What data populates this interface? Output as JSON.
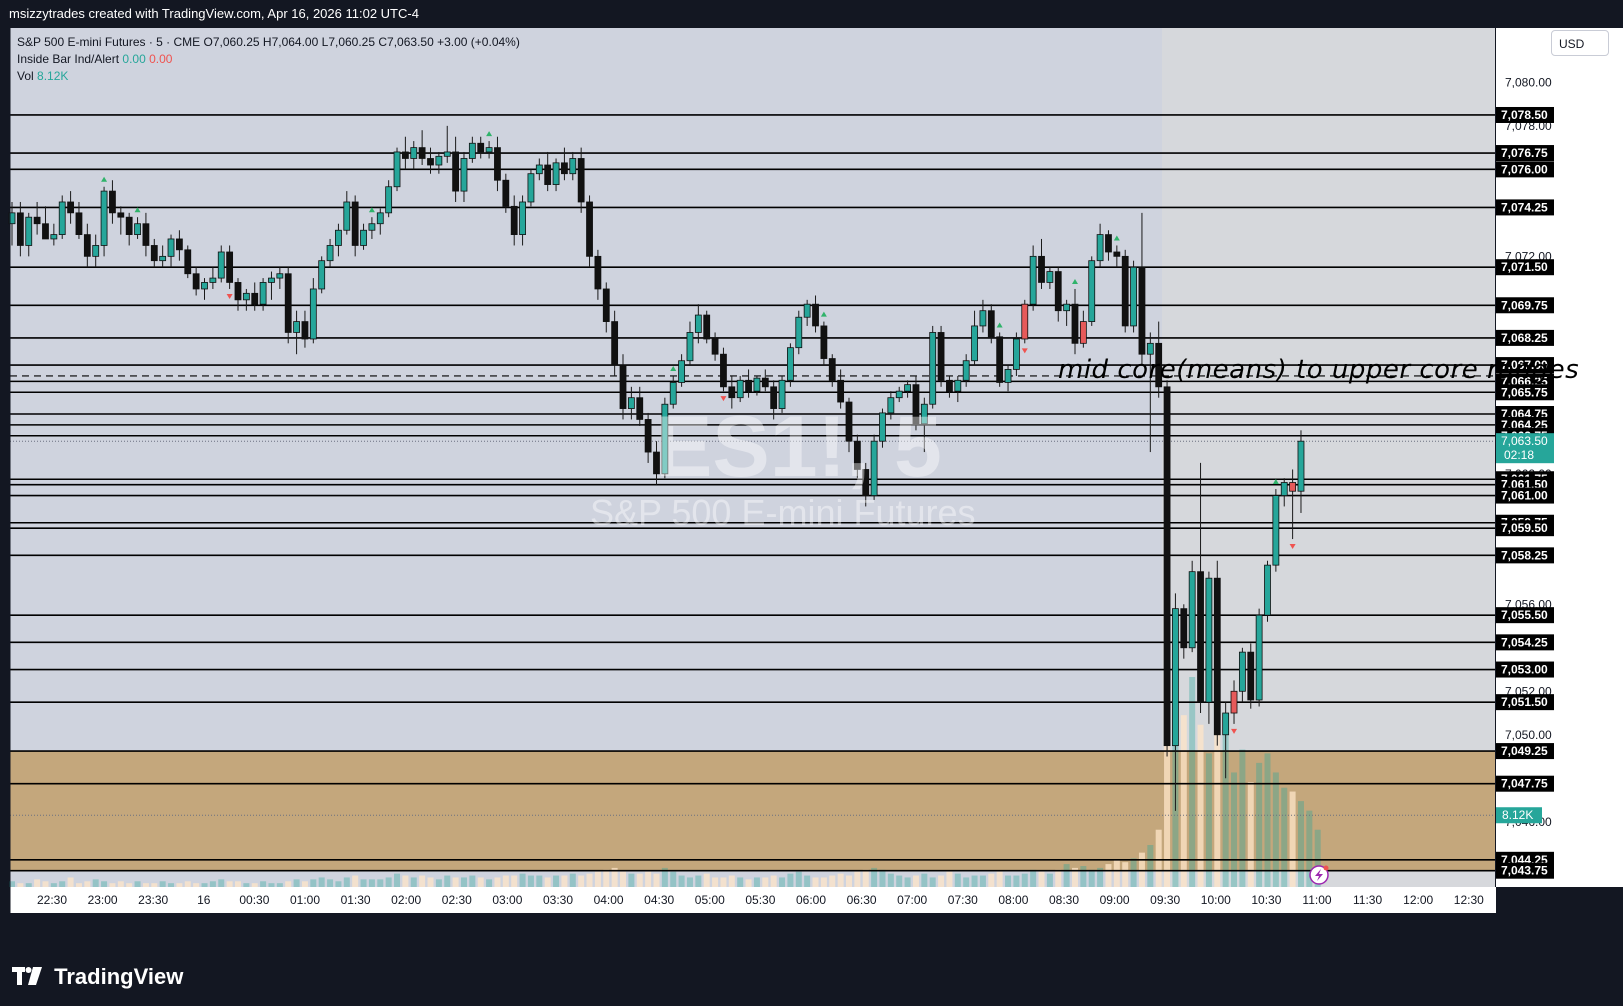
{
  "header": {
    "attribution": "msizzytrades created with TradingView.com, Apr 16, 2026 11:02 UTC-4"
  },
  "legend": {
    "symbol_line": "S&P 500 E-mini Futures · 5 · CME",
    "ohlc": {
      "o": "O7,060.25",
      "h": "H7,064.00",
      "l": "L7,060.25",
      "c": "C7,063.50",
      "chg": "+3.00 (+0.04%)"
    },
    "indicator_name": "Inside Bar Ind/Alert",
    "indicator_v1": "0.00",
    "indicator_v2": "0.00",
    "vol_label": "Vol",
    "vol_value": "8.12K"
  },
  "watermark": {
    "symbol": "ES1!, 5",
    "name": "S&P 500 E-mini Futures"
  },
  "annotation": {
    "text": "mid core(means) to upper core ranges"
  },
  "currency": "USD",
  "logo": "TradingView",
  "colors": {
    "background": "#131722",
    "pane": "#cfd3de",
    "pane_right": "#d6d8dc",
    "zone": "#c4a77c",
    "up": "#26a69a",
    "down": "#111111",
    "inside_bar": "#e65a5a",
    "level_line": "#000000",
    "price_tag": "#26a69a"
  },
  "chart_data": {
    "type": "candlestick",
    "instrument": "S&P 500 E-mini Futures",
    "interval": "5",
    "ylim": [
      7043.0,
      7082.5
    ],
    "y_ticks": [
      "7,080.00",
      "7,078.00",
      "7,072.00",
      "7,062.00",
      "7,056.00",
      "7,052.00",
      "7,050.00",
      "7,046.00"
    ],
    "x_ticks": [
      "22:30",
      "23:00",
      "23:30",
      "16",
      "00:30",
      "01:00",
      "01:30",
      "02:00",
      "02:30",
      "03:00",
      "03:30",
      "04:00",
      "04:30",
      "05:00",
      "05:30",
      "06:00",
      "06:30",
      "07:00",
      "07:30",
      "08:00",
      "08:30",
      "09:00",
      "09:30",
      "10:00",
      "10:30",
      "11:00",
      "11:30",
      "12:00",
      "12:30"
    ],
    "levels": [
      {
        "label": "7,078.50",
        "value": 7078.5
      },
      {
        "label": "7,076.75",
        "value": 7076.75
      },
      {
        "label": "7,076.00",
        "value": 7076.0
      },
      {
        "label": "7,074.25",
        "value": 7074.25
      },
      {
        "label": "7,071.50",
        "value": 7071.5
      },
      {
        "label": "7,069.75",
        "value": 7069.75
      },
      {
        "label": "7,068.25",
        "value": 7068.25
      },
      {
        "label": "7,067.00",
        "value": 7067.0
      },
      {
        "label": "7,066.25",
        "value": 7066.25
      },
      {
        "label": "7,065.75",
        "value": 7065.75
      },
      {
        "label": "7,064.75",
        "value": 7064.75
      },
      {
        "label": "7,064.25",
        "value": 7064.25
      },
      {
        "label": "7,063.75",
        "value": 7063.75
      },
      {
        "label": "7,061.75",
        "value": 7061.75
      },
      {
        "label": "7,061.50",
        "value": 7061.5
      },
      {
        "label": "7,061.00",
        "value": 7061.0
      },
      {
        "label": "7,059.75",
        "value": 7059.75
      },
      {
        "label": "7,059.50",
        "value": 7059.5
      },
      {
        "label": "7,058.25",
        "value": 7058.25
      },
      {
        "label": "7,055.50",
        "value": 7055.5
      },
      {
        "label": "7,054.25",
        "value": 7054.25
      },
      {
        "label": "7,053.00",
        "value": 7053.0
      },
      {
        "label": "7,051.50",
        "value": 7051.5
      },
      {
        "label": "7,049.25",
        "value": 7049.25
      },
      {
        "label": "7,047.75",
        "value": 7047.75
      },
      {
        "label": "7,044.25",
        "value": 7044.25
      },
      {
        "label": "7,043.75",
        "value": 7043.75
      }
    ],
    "dashed_level": 7066.5,
    "zone": {
      "from": 7043.75,
      "to": 7049.25
    },
    "last_price": {
      "label": "7,063.50",
      "value": 7063.5,
      "countdown": "02:18"
    },
    "volume_tag": "8.12K",
    "candles": [
      [
        7073.5,
        7074.5,
        7072.5,
        7074.0
      ],
      [
        7074.0,
        7074.5,
        7072.0,
        7072.5
      ],
      [
        7072.5,
        7074.0,
        7072.0,
        7073.8
      ],
      [
        7073.8,
        7074.5,
        7073.0,
        7073.5
      ],
      [
        7073.5,
        7074.3,
        7072.8,
        7072.8
      ],
      [
        7072.8,
        7073.5,
        7072.5,
        7073.0
      ],
      [
        7073.0,
        7074.8,
        7072.8,
        7074.5
      ],
      [
        7074.5,
        7075.0,
        7073.5,
        7074.0
      ],
      [
        7074.0,
        7074.5,
        7072.8,
        7073.0
      ],
      [
        7073.0,
        7073.5,
        7071.5,
        7072.0
      ],
      [
        7072.0,
        7073.0,
        7071.5,
        7072.5
      ],
      [
        7072.5,
        7075.2,
        7072.0,
        7075.0
      ],
      [
        7075.0,
        7075.5,
        7073.5,
        7074.0
      ],
      [
        7074.0,
        7074.3,
        7073.0,
        7073.8
      ],
      [
        7073.8,
        7074.0,
        7072.5,
        7073.0
      ],
      [
        7073.0,
        7073.8,
        7072.8,
        7073.5
      ],
      [
        7073.5,
        7074.0,
        7072.0,
        7072.5
      ],
      [
        7072.5,
        7072.8,
        7071.5,
        7071.8
      ],
      [
        7071.8,
        7072.5,
        7071.5,
        7072.0
      ],
      [
        7072.0,
        7073.0,
        7071.5,
        7072.8
      ],
      [
        7072.8,
        7073.2,
        7071.8,
        7072.3
      ],
      [
        7072.3,
        7072.5,
        7071.0,
        7071.2
      ],
      [
        7071.2,
        7071.5,
        7070.2,
        7070.5
      ],
      [
        7070.5,
        7071.0,
        7070.0,
        7070.8
      ],
      [
        7070.8,
        7071.5,
        7070.5,
        7071.0
      ],
      [
        7071.0,
        7072.5,
        7070.8,
        7072.2
      ],
      [
        7072.2,
        7072.5,
        7070.5,
        7070.8
      ],
      [
        7070.8,
        7071.0,
        7069.5,
        7070.0
      ],
      [
        7070.0,
        7070.5,
        7069.5,
        7070.3
      ],
      [
        7070.3,
        7070.8,
        7069.5,
        7069.8
      ],
      [
        7069.8,
        7071.0,
        7069.5,
        7070.8
      ],
      [
        7070.8,
        7071.3,
        7070.0,
        7071.0
      ],
      [
        7071.0,
        7071.5,
        7070.5,
        7071.2
      ],
      [
        7071.2,
        7071.5,
        7068.0,
        7068.5
      ],
      [
        7068.5,
        7069.5,
        7067.5,
        7069.0
      ],
      [
        7069.0,
        7069.5,
        7067.8,
        7068.2
      ],
      [
        7068.2,
        7071.0,
        7068.0,
        7070.5
      ],
      [
        7070.5,
        7072.0,
        7070.3,
        7071.8
      ],
      [
        7071.8,
        7072.8,
        7071.5,
        7072.5
      ],
      [
        7072.5,
        7073.5,
        7072.0,
        7073.2
      ],
      [
        7073.2,
        7075.0,
        7073.0,
        7074.5
      ],
      [
        7074.5,
        7074.8,
        7072.0,
        7072.5
      ],
      [
        7072.5,
        7073.5,
        7072.3,
        7073.2
      ],
      [
        7073.2,
        7073.8,
        7072.8,
        7073.5
      ],
      [
        7073.5,
        7074.2,
        7073.0,
        7074.0
      ],
      [
        7074.0,
        7075.5,
        7073.8,
        7075.2
      ],
      [
        7075.2,
        7077.0,
        7075.0,
        7076.8
      ],
      [
        7076.8,
        7077.5,
        7076.0,
        7076.5
      ],
      [
        7076.5,
        7077.3,
        7076.0,
        7077.0
      ],
      [
        7077.0,
        7077.8,
        7076.2,
        7076.5
      ],
      [
        7076.5,
        7077.0,
        7075.8,
        7076.2
      ],
      [
        7076.2,
        7076.8,
        7075.8,
        7076.6
      ],
      [
        7076.6,
        7078.0,
        7076.3,
        7076.8
      ],
      [
        7076.8,
        7077.5,
        7074.5,
        7075.0
      ],
      [
        7075.0,
        7076.8,
        7074.5,
        7076.5
      ],
      [
        7076.5,
        7077.5,
        7076.3,
        7077.2
      ],
      [
        7077.2,
        7077.5,
        7076.5,
        7076.8
      ],
      [
        7076.8,
        7077.3,
        7076.5,
        7077.0
      ],
      [
        7077.0,
        7077.5,
        7075.0,
        7075.5
      ],
      [
        7075.5,
        7075.8,
        7074.0,
        7074.3
      ],
      [
        7074.3,
        7074.8,
        7072.5,
        7073.0
      ],
      [
        7073.0,
        7074.8,
        7072.5,
        7074.5
      ],
      [
        7074.5,
        7076.0,
        7074.3,
        7075.8
      ],
      [
        7075.8,
        7076.5,
        7075.5,
        7076.2
      ],
      [
        7076.2,
        7076.8,
        7075.0,
        7075.3
      ],
      [
        7075.3,
        7076.5,
        7075.0,
        7076.3
      ],
      [
        7076.3,
        7077.0,
        7075.5,
        7075.8
      ],
      [
        7075.8,
        7076.8,
        7075.5,
        7076.5
      ],
      [
        7076.5,
        7077.0,
        7074.0,
        7074.5
      ],
      [
        7074.5,
        7074.8,
        7071.5,
        7072.0
      ],
      [
        7072.0,
        7072.3,
        7070.0,
        7070.5
      ],
      [
        7070.5,
        7070.8,
        7068.5,
        7069.0
      ],
      [
        7069.0,
        7069.5,
        7066.5,
        7067.0
      ],
      [
        7067.0,
        7067.5,
        7064.5,
        7065.0
      ],
      [
        7065.0,
        7066.0,
        7064.5,
        7065.5
      ],
      [
        7065.5,
        7066.0,
        7064.2,
        7064.5
      ],
      [
        7064.5,
        7064.8,
        7062.5,
        7063.0
      ],
      [
        7063.0,
        7063.5,
        7061.5,
        7062.0
      ],
      [
        7062.0,
        7065.5,
        7061.8,
        7065.2
      ],
      [
        7065.2,
        7066.5,
        7065.0,
        7066.2
      ],
      [
        7066.2,
        7067.5,
        7066.0,
        7067.2
      ],
      [
        7067.2,
        7069.0,
        7067.0,
        7068.5
      ],
      [
        7068.5,
        7069.8,
        7068.0,
        7069.3
      ],
      [
        7069.3,
        7069.5,
        7068.0,
        7068.2
      ],
      [
        7068.2,
        7068.5,
        7067.2,
        7067.5
      ],
      [
        7067.5,
        7067.8,
        7065.8,
        7066.0
      ],
      [
        7066.0,
        7066.5,
        7065.0,
        7065.5
      ],
      [
        7065.5,
        7066.5,
        7065.3,
        7066.3
      ],
      [
        7066.3,
        7066.8,
        7065.5,
        7065.8
      ],
      [
        7065.8,
        7066.5,
        7065.6,
        7066.4
      ],
      [
        7066.4,
        7066.8,
        7065.8,
        7066.0
      ],
      [
        7066.0,
        7066.3,
        7064.5,
        7065.0
      ],
      [
        7065.0,
        7066.5,
        7064.8,
        7066.3
      ],
      [
        7066.3,
        7068.0,
        7066.0,
        7067.8
      ],
      [
        7067.8,
        7069.5,
        7067.5,
        7069.2
      ],
      [
        7069.2,
        7070.0,
        7068.8,
        7069.8
      ],
      [
        7069.8,
        7070.2,
        7068.5,
        7068.8
      ],
      [
        7068.8,
        7069.0,
        7067.0,
        7067.3
      ],
      [
        7067.3,
        7067.5,
        7066.0,
        7066.3
      ],
      [
        7066.3,
        7066.8,
        7065.0,
        7065.3
      ],
      [
        7065.3,
        7065.5,
        7063.0,
        7063.5
      ],
      [
        7063.5,
        7063.8,
        7061.8,
        7062.2
      ],
      [
        7062.2,
        7062.5,
        7060.5,
        7061.0
      ],
      [
        7061.0,
        7063.8,
        7060.8,
        7063.5
      ],
      [
        7063.5,
        7065.0,
        7063.2,
        7064.8
      ],
      [
        7064.8,
        7065.8,
        7064.5,
        7065.5
      ],
      [
        7065.5,
        7066.0,
        7065.3,
        7065.8
      ],
      [
        7065.8,
        7066.3,
        7065.5,
        7066.1
      ],
      [
        7066.1,
        7066.5,
        7064.0,
        7064.3
      ],
      [
        7064.3,
        7065.5,
        7063.0,
        7065.2
      ],
      [
        7065.2,
        7068.8,
        7065.0,
        7068.5
      ],
      [
        7068.5,
        7068.8,
        7066.0,
        7066.3
      ],
      [
        7066.3,
        7066.5,
        7065.5,
        7065.8
      ],
      [
        7065.8,
        7066.5,
        7065.3,
        7066.3
      ],
      [
        7066.3,
        7067.5,
        7066.0,
        7067.2
      ],
      [
        7067.2,
        7069.5,
        7067.0,
        7068.8
      ],
      [
        7068.8,
        7070.0,
        7068.5,
        7069.5
      ],
      [
        7069.5,
        7069.8,
        7068.0,
        7068.3
      ],
      [
        7068.3,
        7068.5,
        7066.0,
        7066.2
      ],
      [
        7066.2,
        7067.0,
        7065.8,
        7066.8
      ],
      [
        7066.8,
        7068.5,
        7066.5,
        7068.2
      ],
      [
        7068.2,
        7070.0,
        7068.0,
        7069.8
      ],
      [
        7069.8,
        7072.5,
        7069.5,
        7072.0
      ],
      [
        7072.0,
        7072.8,
        7070.5,
        7070.8
      ],
      [
        7070.8,
        7071.5,
        7070.5,
        7071.3
      ],
      [
        7071.3,
        7071.5,
        7069.0,
        7069.5
      ],
      [
        7069.5,
        7070.0,
        7068.8,
        7069.8
      ],
      [
        7069.8,
        7070.5,
        7067.5,
        7068.0
      ],
      [
        7068.0,
        7069.5,
        7067.8,
        7069.0
      ],
      [
        7069.0,
        7072.0,
        7068.8,
        7071.8
      ],
      [
        7071.8,
        7073.5,
        7071.5,
        7073.0
      ],
      [
        7073.0,
        7073.2,
        7071.8,
        7072.2
      ],
      [
        7072.2,
        7072.5,
        7071.5,
        7072.0
      ],
      [
        7072.0,
        7072.3,
        7068.5,
        7068.8
      ],
      [
        7068.8,
        7071.8,
        7068.5,
        7071.5
      ],
      [
        7071.5,
        7074.0,
        7067.0,
        7067.5
      ],
      [
        7067.5,
        7068.5,
        7063.0,
        7068.0
      ],
      [
        7068.0,
        7069.0,
        7065.5,
        7066.0
      ],
      [
        7066.0,
        7066.3,
        7049.0,
        7049.5
      ],
      [
        7049.5,
        7056.5,
        7046.5,
        7055.8
      ],
      [
        7055.8,
        7056.0,
        7053.5,
        7054.0
      ],
      [
        7054.0,
        7058.0,
        7053.8,
        7057.5
      ],
      [
        7057.5,
        7062.5,
        7051.0,
        7051.5
      ],
      [
        7051.5,
        7057.5,
        7050.5,
        7057.2
      ],
      [
        7057.2,
        7058.0,
        7049.5,
        7050.0
      ],
      [
        7050.0,
        7051.5,
        7048.0,
        7051.0
      ],
      [
        7051.0,
        7052.5,
        7050.5,
        7052.0
      ],
      [
        7052.0,
        7054.0,
        7051.5,
        7053.8
      ],
      [
        7053.8,
        7054.2,
        7051.2,
        7051.6
      ],
      [
        7051.6,
        7055.8,
        7051.3,
        7055.5
      ],
      [
        7055.5,
        7058.0,
        7055.2,
        7057.8
      ],
      [
        7057.8,
        7061.3,
        7057.5,
        7061.0
      ],
      [
        7061.0,
        7061.8,
        7060.5,
        7061.6
      ],
      [
        7061.6,
        7062.2,
        7059.0,
        7061.2
      ],
      [
        7061.2,
        7064.0,
        7060.2,
        7063.5
      ]
    ],
    "inside_bar_markers": [
      {
        "index": 11,
        "dir": "up"
      },
      {
        "index": 15,
        "dir": "up"
      },
      {
        "index": 26,
        "dir": "down"
      },
      {
        "index": 43,
        "dir": "up"
      },
      {
        "index": 57,
        "dir": "up"
      },
      {
        "index": 79,
        "dir": "up"
      },
      {
        "index": 85,
        "dir": "down"
      },
      {
        "index": 97,
        "dir": "up"
      },
      {
        "index": 118,
        "dir": "up"
      },
      {
        "index": 121,
        "dir": "down"
      },
      {
        "index": 127,
        "dir": "up"
      },
      {
        "index": 132,
        "dir": "up"
      },
      {
        "index": 146,
        "dir": "down"
      },
      {
        "index": 151,
        "dir": "up"
      },
      {
        "index": 153,
        "dir": "down"
      }
    ],
    "red_bars": [
      121,
      128,
      146,
      153
    ],
    "volume": [
      3,
      2,
      2,
      4,
      3,
      2,
      3,
      5,
      2,
      3,
      4,
      3,
      2,
      3,
      2,
      3,
      2,
      2,
      3,
      2,
      2,
      3,
      2,
      2,
      3,
      4,
      3,
      3,
      2,
      2,
      3,
      2,
      2,
      3,
      4,
      3,
      4,
      5,
      4,
      3,
      5,
      6,
      4,
      4,
      4,
      5,
      7,
      6,
      5,
      6,
      5,
      4,
      6,
      5,
      5,
      6,
      5,
      4,
      5,
      6,
      6,
      7,
      6,
      6,
      5,
      6,
      6,
      7,
      6,
      7,
      8,
      9,
      10,
      8,
      7,
      7,
      8,
      7,
      10,
      8,
      6,
      5,
      6,
      7,
      5,
      5,
      6,
      5,
      4,
      5,
      5,
      6,
      5,
      7,
      8,
      6,
      5,
      5,
      6,
      7,
      6,
      8,
      9,
      10,
      9,
      7,
      6,
      5,
      6,
      7,
      5,
      6,
      8,
      7,
      5,
      6,
      6,
      7,
      8,
      6,
      6,
      7,
      9,
      8,
      7,
      9,
      12,
      10,
      11,
      9,
      10,
      12,
      14,
      13,
      15,
      18,
      22,
      30,
      100,
      75,
      90,
      110,
      85,
      70,
      95,
      80,
      60,
      72,
      55,
      65,
      70,
      60,
      52,
      50,
      45,
      40,
      30
    ]
  }
}
